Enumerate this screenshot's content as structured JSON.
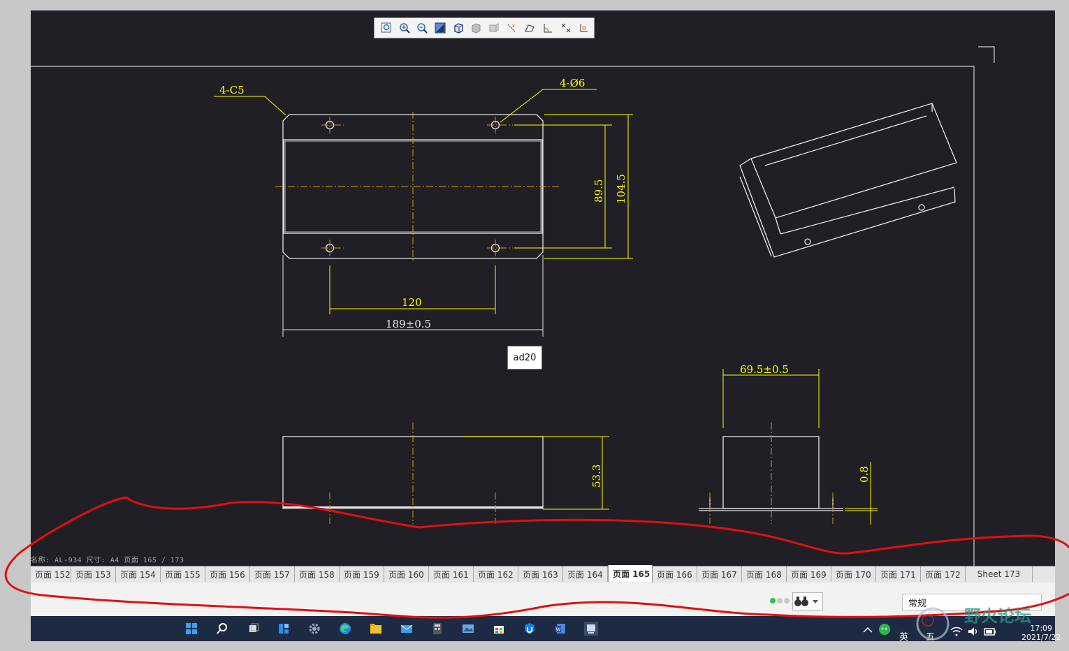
{
  "toolbar": {
    "buttons": [
      "zoom-window",
      "zoom-in",
      "zoom-out",
      "zoom-extents",
      "view-cube",
      "shaded-view",
      "wireframe-view",
      "measure-distance",
      "measure-area",
      "measure-angle",
      "clear-measure",
      "measure-coordinate"
    ]
  },
  "drawing": {
    "labels": {
      "chamfer": "4-C5",
      "holes": "4-Ø6",
      "hole_height": "89.5",
      "total_height": "104.5",
      "hole_spacing": "120",
      "total_width": "189±0.5",
      "side_height": "53.3",
      "end_width": "69.5±0.5",
      "thickness": "0.8"
    },
    "tag": "ad20",
    "info_line": "名称: AL-934  尺寸: A4  页面 165 / 173"
  },
  "tabs": {
    "items": [
      "页面 152",
      "页面 153",
      "页面 154",
      "页面 155",
      "页面 156",
      "页面 157",
      "页面 158",
      "页面 159",
      "页面 160",
      "页面 161",
      "页面 162",
      "页面 163",
      "页面 164",
      "页面 165",
      "页面 166",
      "页面 167",
      "页面 168",
      "页面 169",
      "页面 170",
      "页面 171",
      "页面 172",
      "Sheet 173"
    ],
    "active_index": 13
  },
  "status": {
    "style_value": "常规"
  },
  "taskbar": {
    "ime_lang": "英",
    "ime_mode": "五",
    "time": "17:09",
    "date": "2021/7/22"
  },
  "watermark": {
    "text": "野火论坛"
  },
  "colors": {
    "canvas_bg": "#1f1f25",
    "outline": "#e8e8e8",
    "dimension": "#ffff00",
    "centerline": "#c8a000",
    "annotation_red": "#e01010"
  }
}
